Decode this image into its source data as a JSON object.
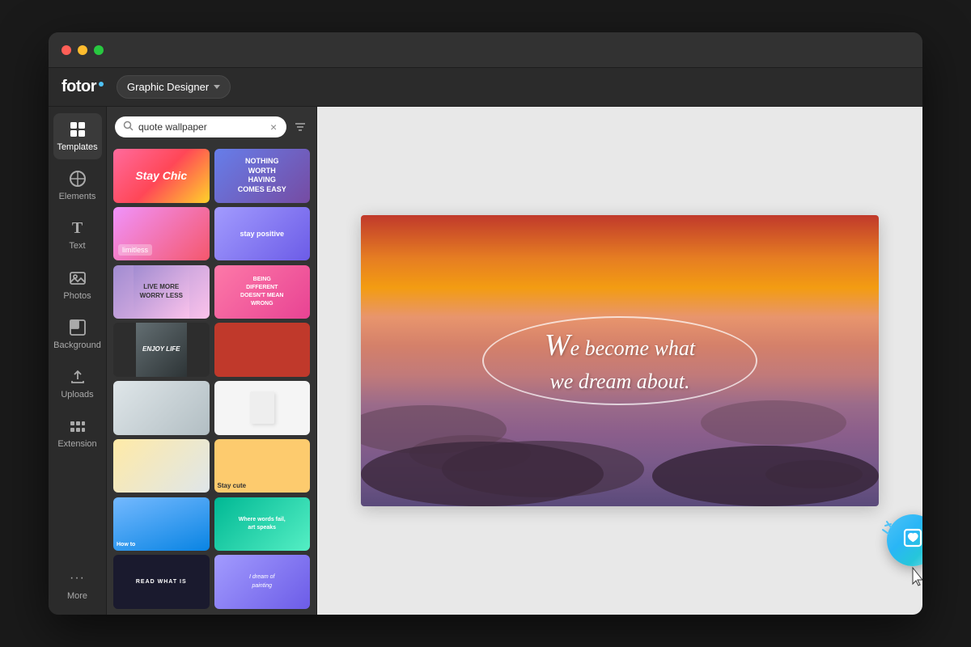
{
  "app": {
    "title": "Fotor",
    "logo_text": "fotor",
    "mode_label": "Graphic Designer",
    "mode_dropdown_char": "▾"
  },
  "titlebar": {
    "lights": [
      "red",
      "yellow",
      "green"
    ]
  },
  "sidebar": {
    "items": [
      {
        "id": "templates",
        "label": "Templates",
        "icon": "⊞",
        "active": true
      },
      {
        "id": "elements",
        "label": "Elements",
        "icon": "✦",
        "active": false
      },
      {
        "id": "text",
        "label": "Text",
        "icon": "T",
        "active": false
      },
      {
        "id": "photos",
        "label": "Photos",
        "icon": "🖼",
        "active": false
      },
      {
        "id": "background",
        "label": "Background",
        "icon": "◰",
        "active": false
      },
      {
        "id": "uploads",
        "label": "Uploads",
        "icon": "⬆",
        "active": false
      },
      {
        "id": "extension",
        "label": "Extension",
        "icon": "⋮⋮",
        "active": false
      }
    ],
    "more_label": "More",
    "more_dots": "···"
  },
  "search": {
    "placeholder": "quote wallpaper",
    "value": "quote wallpaper",
    "clear_char": "×",
    "filter_char": "⚙"
  },
  "canvas": {
    "quote_line1": "e become what",
    "quote_letter": "W",
    "quote_line2": "we dream about.",
    "fav_button_title": "Add to favorites"
  },
  "templates": {
    "items": [
      {
        "id": 1,
        "class": "tc-1",
        "text": "Stay Chic"
      },
      {
        "id": 2,
        "class": "tc-2",
        "text": "NOTHING WORTH HAVING COMES EASY"
      },
      {
        "id": 3,
        "class": "tc-3",
        "text": ""
      },
      {
        "id": 4,
        "class": "tc-4",
        "text": "limitless"
      },
      {
        "id": 5,
        "class": "tc-5",
        "text": ""
      },
      {
        "id": 6,
        "class": "tc-6",
        "text": "Live more Worry less"
      },
      {
        "id": 7,
        "class": "tc-7",
        "text": "BEING DIFFERENT DOESN'T MEAN WRONG"
      },
      {
        "id": 8,
        "class": "tc-8",
        "text": "ENJOY LIFE"
      },
      {
        "id": 9,
        "class": "tc-9",
        "text": ""
      },
      {
        "id": 10,
        "class": "tc-10",
        "text": ""
      },
      {
        "id": 11,
        "class": "tc-11",
        "text": ""
      },
      {
        "id": 12,
        "class": "tc-12",
        "text": ""
      },
      {
        "id": 13,
        "class": "tc-13",
        "text": ""
      },
      {
        "id": 14,
        "class": "tc-14",
        "text": "Stay cute"
      },
      {
        "id": 15,
        "class": "tc-15",
        "text": ""
      },
      {
        "id": 16,
        "class": "tc-16",
        "text": ""
      },
      {
        "id": 17,
        "class": "tc-17",
        "text": ""
      },
      {
        "id": 18,
        "class": "tc-18",
        "text": "Where words fail, art speaks"
      }
    ]
  }
}
